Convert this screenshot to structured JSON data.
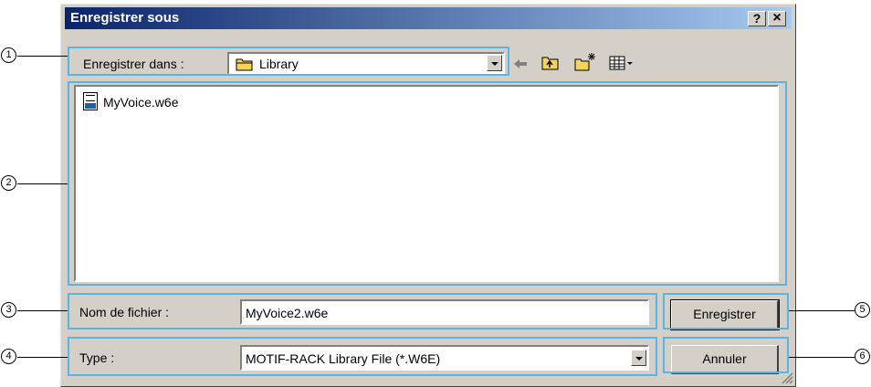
{
  "dialog": {
    "title": "Enregistrer sous",
    "help_glyph": "?",
    "close_glyph": "×"
  },
  "toolbar": {
    "save_in_label": "Enregistrer dans :",
    "folder_name": "Library",
    "icons": [
      "back-arrow-icon",
      "up-folder-icon",
      "new-folder-icon",
      "view-menu-icon"
    ]
  },
  "files": [
    {
      "name": "MyVoice.w6e",
      "icon": "w6e-file-icon"
    }
  ],
  "filename_label": "Nom de fichier :",
  "filename_value": "MyVoice2.w6e",
  "type_label": "Type :",
  "type_value": "MOTIF-RACK Library File (*.W6E)",
  "buttons": {
    "save": "Enregistrer",
    "cancel": "Annuler"
  },
  "callouts": [
    "1",
    "2",
    "3",
    "4",
    "5",
    "6"
  ],
  "colors": {
    "title_start": "#0a246a",
    "title_end": "#a6caf0",
    "highlight": "#5ab4e6",
    "face": "#d4d0c8"
  }
}
